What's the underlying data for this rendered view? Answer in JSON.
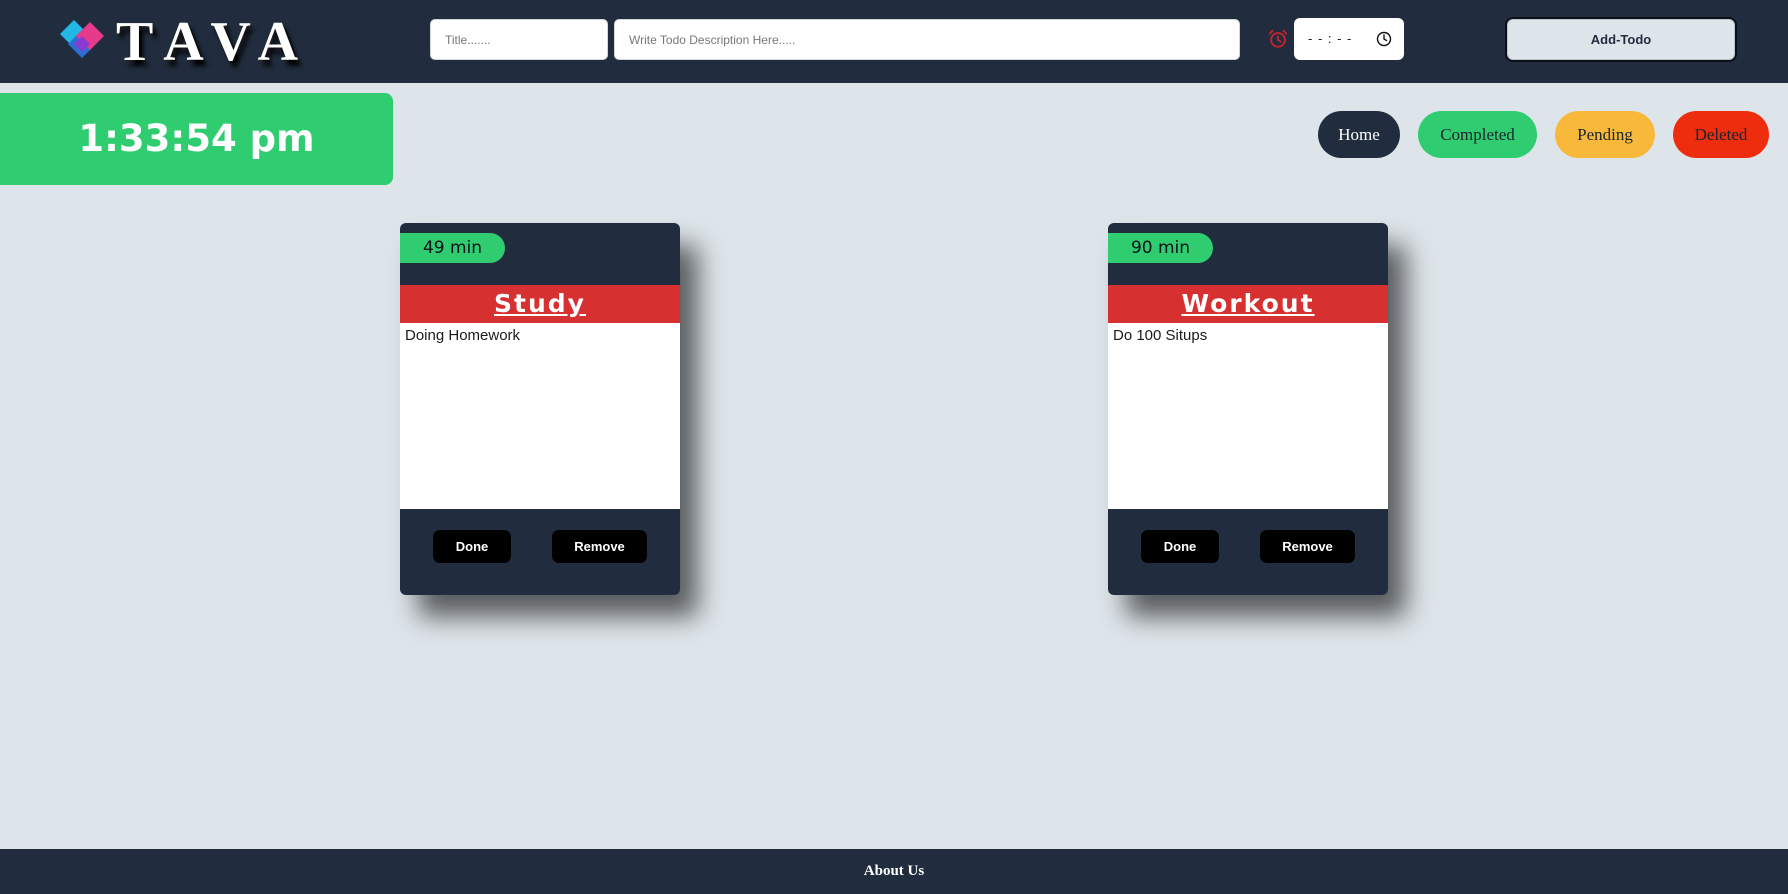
{
  "header": {
    "logo_text": "TAVA",
    "title_placeholder": "Title.......",
    "description_placeholder": "Write Todo Description Here.....",
    "time_value": "- - : - -",
    "add_button_label": "Add-Todo"
  },
  "clock": {
    "time": "1:33:54 pm"
  },
  "nav": {
    "home": "Home",
    "completed": "Completed",
    "pending": "Pending",
    "deleted": "Deleted"
  },
  "todos": [
    {
      "duration": "49 min",
      "title": "Study",
      "description": "Doing Homework",
      "done_label": "Done",
      "remove_label": "Remove"
    },
    {
      "duration": "90 min",
      "title": "Workout",
      "description": "Do 100 Situps",
      "done_label": "Done",
      "remove_label": "Remove"
    }
  ],
  "footer": {
    "about_label": "About Us"
  },
  "colors": {
    "navy": "#212d3e",
    "green": "#2fcc70",
    "yellow": "#f8b93b",
    "red": "#ee2c0e",
    "card_header_red": "#d63031",
    "background": "#dee5ea"
  },
  "icons": [
    "tava-logo-icon",
    "alarm-clock-icon",
    "clock-icon"
  ]
}
